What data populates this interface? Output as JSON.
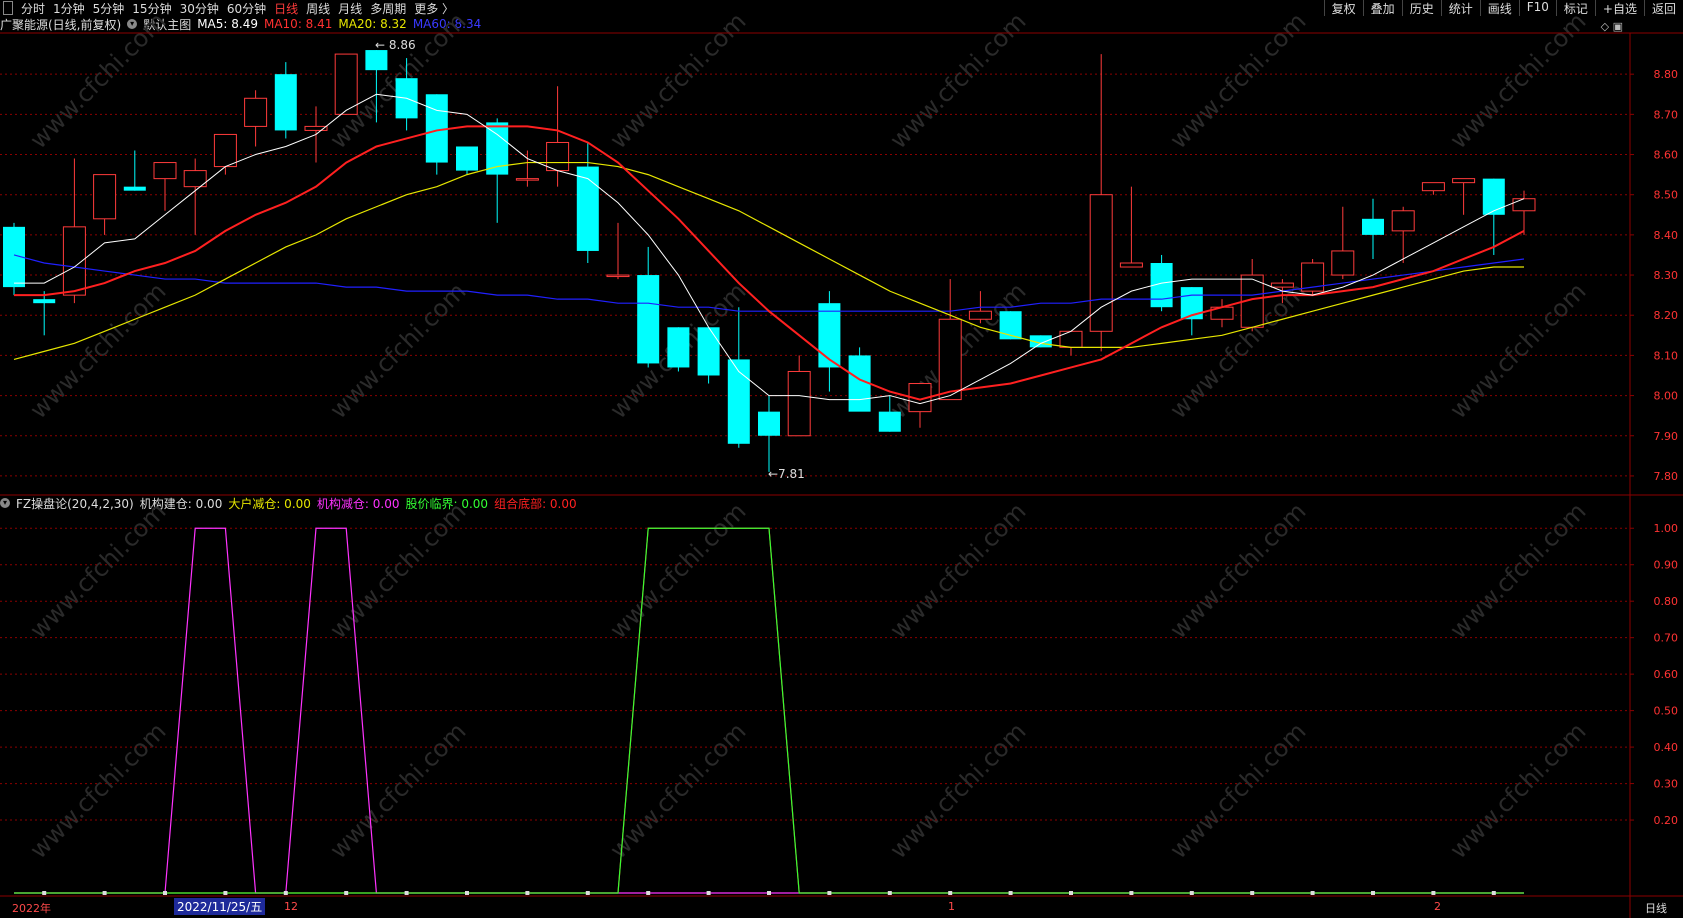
{
  "toolbar": {
    "tabs": [
      "分时",
      "1分钟",
      "5分钟",
      "15分钟",
      "30分钟",
      "60分钟",
      "日线",
      "周线",
      "月线",
      "多周期",
      "更多 〉"
    ],
    "active": "日线",
    "right": [
      "复权",
      "叠加",
      "历史",
      "统计",
      "画线",
      "F10",
      "标记",
      "+自选",
      "返回"
    ]
  },
  "main_info": {
    "stock": "广聚能源(日线,前复权)",
    "template": "默认主图",
    "ma5": "MA5: 8.49",
    "ma10": "MA10: 8.41",
    "ma20": "MA20: 8.32",
    "ma60": "MA60: 8.34"
  },
  "sub_info": {
    "indicator": "FZ操盘论(20,4,2,30)",
    "s1": "机构建仓: 0.00",
    "s2": "大户减仓: 0.00",
    "s3": "机构减仓: 0.00",
    "s4": "股价临界: 0.00",
    "s5": "组合底部: 0.00"
  },
  "annotations": {
    "high": "8.86",
    "low": "7.81"
  },
  "x_axis": {
    "year": "2022年",
    "selected_date": "2022/11/25/五",
    "m12": "12",
    "m1": "1",
    "m2": "2",
    "period": "日线"
  },
  "watermark": "www.cfchi.com",
  "colors": {
    "up": "#ff3b3b",
    "down": "#00ffff",
    "ma5": "#ffffff",
    "ma10": "#ff2020",
    "ma20": "#e6e600",
    "ma60": "#2020ff",
    "grid": "#8b0000"
  },
  "chart_data": [
    {
      "type": "candlestick",
      "title": "广聚能源(日线,前复权)",
      "y_ticks": [
        7.8,
        7.9,
        8.0,
        8.1,
        8.2,
        8.3,
        8.4,
        8.5,
        8.6,
        8.7,
        8.8
      ],
      "ylim": [
        7.76,
        8.9
      ],
      "candles": [
        {
          "o": 8.42,
          "h": 8.43,
          "l": 8.25,
          "c": 8.27
        },
        {
          "o": 8.24,
          "h": 8.26,
          "l": 8.15,
          "c": 8.23
        },
        {
          "o": 8.25,
          "h": 8.59,
          "l": 8.23,
          "c": 8.42
        },
        {
          "o": 8.44,
          "h": 8.55,
          "l": 8.4,
          "c": 8.55
        },
        {
          "o": 8.52,
          "h": 8.61,
          "l": 8.51,
          "c": 8.51
        },
        {
          "o": 8.54,
          "h": 8.55,
          "l": 8.46,
          "c": 8.58
        },
        {
          "o": 8.52,
          "h": 8.59,
          "l": 8.4,
          "c": 8.56
        },
        {
          "o": 8.57,
          "h": 8.65,
          "l": 8.55,
          "c": 8.65
        },
        {
          "o": 8.67,
          "h": 8.76,
          "l": 8.62,
          "c": 8.74
        },
        {
          "o": 8.8,
          "h": 8.83,
          "l": 8.64,
          "c": 8.66
        },
        {
          "o": 8.66,
          "h": 8.72,
          "l": 8.58,
          "c": 8.67
        },
        {
          "o": 8.7,
          "h": 8.85,
          "l": 8.7,
          "c": 8.85
        },
        {
          "o": 8.86,
          "h": 8.86,
          "l": 8.68,
          "c": 8.81
        },
        {
          "o": 8.79,
          "h": 8.84,
          "l": 8.66,
          "c": 8.69
        },
        {
          "o": 8.75,
          "h": 8.75,
          "l": 8.55,
          "c": 8.58
        },
        {
          "o": 8.62,
          "h": 8.62,
          "l": 8.55,
          "c": 8.56
        },
        {
          "o": 8.68,
          "h": 8.69,
          "l": 8.43,
          "c": 8.55
        },
        {
          "o": 8.54,
          "h": 8.61,
          "l": 8.52,
          "c": 8.54
        },
        {
          "o": 8.56,
          "h": 8.77,
          "l": 8.52,
          "c": 8.63
        },
        {
          "o": 8.57,
          "h": 8.63,
          "l": 8.33,
          "c": 8.36
        },
        {
          "o": 8.3,
          "h": 8.43,
          "l": 8.29,
          "c": 8.3
        },
        {
          "o": 8.3,
          "h": 8.37,
          "l": 8.07,
          "c": 8.08
        },
        {
          "o": 8.17,
          "h": 8.17,
          "l": 8.06,
          "c": 8.07
        },
        {
          "o": 8.17,
          "h": 8.17,
          "l": 8.03,
          "c": 8.05
        },
        {
          "o": 8.09,
          "h": 8.22,
          "l": 7.87,
          "c": 7.88
        },
        {
          "o": 7.96,
          "h": 8.0,
          "l": 7.81,
          "c": 7.9
        },
        {
          "o": 7.9,
          "h": 8.1,
          "l": 7.9,
          "c": 8.06
        },
        {
          "o": 8.23,
          "h": 8.26,
          "l": 8.01,
          "c": 8.07
        },
        {
          "o": 8.1,
          "h": 8.12,
          "l": 7.97,
          "c": 7.96
        },
        {
          "o": 7.96,
          "h": 8.0,
          "l": 7.91,
          "c": 7.91
        },
        {
          "o": 7.96,
          "h": 8.02,
          "l": 7.92,
          "c": 8.03
        },
        {
          "o": 7.99,
          "h": 8.29,
          "l": 7.99,
          "c": 8.19
        },
        {
          "o": 8.19,
          "h": 8.26,
          "l": 8.18,
          "c": 8.21
        },
        {
          "o": 8.21,
          "h": 8.21,
          "l": 8.14,
          "c": 8.14
        },
        {
          "o": 8.15,
          "h": 8.15,
          "l": 8.12,
          "c": 8.12
        },
        {
          "o": 8.12,
          "h": 8.15,
          "l": 8.1,
          "c": 8.16
        },
        {
          "o": 8.16,
          "h": 8.85,
          "l": 8.11,
          "c": 8.5
        },
        {
          "o": 8.32,
          "h": 8.52,
          "l": 8.32,
          "c": 8.33
        },
        {
          "o": 8.33,
          "h": 8.35,
          "l": 8.21,
          "c": 8.22
        },
        {
          "o": 8.27,
          "h": 8.27,
          "l": 8.15,
          "c": 8.19
        },
        {
          "o": 8.19,
          "h": 8.24,
          "l": 8.17,
          "c": 8.22
        },
        {
          "o": 8.17,
          "h": 8.34,
          "l": 8.16,
          "c": 8.3
        },
        {
          "o": 8.27,
          "h": 8.29,
          "l": 8.23,
          "c": 8.28
        },
        {
          "o": 8.26,
          "h": 8.34,
          "l": 8.25,
          "c": 8.33
        },
        {
          "o": 8.3,
          "h": 8.47,
          "l": 8.29,
          "c": 8.36
        },
        {
          "o": 8.44,
          "h": 8.49,
          "l": 8.34,
          "c": 8.4
        },
        {
          "o": 8.41,
          "h": 8.47,
          "l": 8.33,
          "c": 8.46
        },
        {
          "o": 8.51,
          "h": 8.53,
          "l": 8.5,
          "c": 8.53
        },
        {
          "o": 8.53,
          "h": 8.54,
          "l": 8.45,
          "c": 8.54
        },
        {
          "o": 8.54,
          "h": 8.54,
          "l": 8.35,
          "c": 8.45
        },
        {
          "o": 8.46,
          "h": 8.51,
          "l": 8.4,
          "c": 8.49
        }
      ],
      "ma5": [
        8.28,
        8.28,
        8.32,
        8.38,
        8.39,
        8.45,
        8.51,
        8.57,
        8.6,
        8.62,
        8.65,
        8.71,
        8.75,
        8.74,
        8.71,
        8.7,
        8.65,
        8.59,
        8.56,
        8.54,
        8.48,
        8.4,
        8.3,
        8.17,
        8.06,
        8.0,
        8.0,
        7.99,
        7.99,
        8.0,
        7.98,
        8.0,
        8.04,
        8.08,
        8.13,
        8.16,
        8.22,
        8.26,
        8.28,
        8.29,
        8.29,
        8.29,
        8.26,
        8.25,
        8.27,
        8.3,
        8.34,
        8.38,
        8.42,
        8.46,
        8.49
      ],
      "ma10": [
        8.25,
        8.25,
        8.26,
        8.28,
        8.31,
        8.33,
        8.36,
        8.41,
        8.45,
        8.48,
        8.52,
        8.58,
        8.62,
        8.64,
        8.66,
        8.67,
        8.67,
        8.67,
        8.66,
        8.63,
        8.58,
        8.51,
        8.44,
        8.36,
        8.28,
        8.21,
        8.15,
        8.09,
        8.04,
        8.01,
        7.99,
        8.01,
        8.02,
        8.03,
        8.05,
        8.07,
        8.09,
        8.13,
        8.17,
        8.2,
        8.22,
        8.24,
        8.25,
        8.25,
        8.26,
        8.27,
        8.29,
        8.31,
        8.34,
        8.37,
        8.41
      ],
      "ma20": [
        8.09,
        8.11,
        8.13,
        8.16,
        8.19,
        8.22,
        8.25,
        8.29,
        8.33,
        8.37,
        8.4,
        8.44,
        8.47,
        8.5,
        8.52,
        8.55,
        8.57,
        8.58,
        8.58,
        8.58,
        8.57,
        8.55,
        8.52,
        8.49,
        8.46,
        8.42,
        8.38,
        8.34,
        8.3,
        8.26,
        8.23,
        8.2,
        8.17,
        8.15,
        8.13,
        8.12,
        8.12,
        8.12,
        8.13,
        8.14,
        8.15,
        8.17,
        8.19,
        8.21,
        8.23,
        8.25,
        8.27,
        8.29,
        8.31,
        8.32,
        8.32
      ],
      "ma60": [
        8.35,
        8.33,
        8.32,
        8.31,
        8.3,
        8.29,
        8.29,
        8.28,
        8.28,
        8.28,
        8.28,
        8.27,
        8.27,
        8.26,
        8.26,
        8.26,
        8.25,
        8.25,
        8.24,
        8.24,
        8.23,
        8.23,
        8.22,
        8.22,
        8.21,
        8.21,
        8.21,
        8.21,
        8.21,
        8.21,
        8.21,
        8.21,
        8.22,
        8.22,
        8.23,
        8.23,
        8.24,
        8.24,
        8.24,
        8.25,
        8.25,
        8.25,
        8.26,
        8.27,
        8.28,
        8.29,
        8.3,
        8.31,
        8.32,
        8.33,
        8.34
      ]
    },
    {
      "type": "line",
      "title": "FZ操盘论(20,4,2,30)",
      "y_ticks": [
        0.2,
        0.3,
        0.4,
        0.5,
        0.6,
        0.7,
        0.8,
        0.9,
        1.0
      ],
      "ylim": [
        0,
        1.05
      ],
      "series": [
        {
          "name": "大户减仓",
          "color": "#ff33ff",
          "values": [
            0,
            0,
            0,
            0,
            0,
            0,
            1,
            1,
            0,
            0,
            1,
            1,
            0,
            0,
            0,
            0,
            0,
            0,
            0,
            0,
            0,
            0,
            0,
            0,
            0,
            0,
            0,
            0,
            0,
            0,
            0,
            0,
            0,
            0,
            0,
            0,
            0,
            0,
            0,
            0,
            0,
            0,
            0,
            0,
            0,
            0,
            0,
            0,
            0,
            0,
            0
          ]
        },
        {
          "name": "组合底部",
          "color": "#ff2020",
          "values": [
            0,
            0,
            0,
            0,
            0,
            0,
            0,
            0,
            0,
            0,
            0,
            0,
            0,
            0,
            0,
            0,
            0,
            0,
            0,
            0,
            0,
            1,
            1,
            1,
            1,
            1,
            0,
            0,
            0,
            0,
            0,
            0,
            0,
            0,
            0,
            0,
            0,
            0,
            0,
            0,
            0,
            0,
            0,
            0,
            0,
            0,
            0,
            0,
            0,
            0,
            0
          ]
        },
        {
          "name": "股价临界",
          "color": "#33ff33",
          "values": [
            0,
            0,
            0,
            0,
            0,
            0,
            0,
            0,
            0,
            0,
            0,
            0,
            0,
            0,
            0,
            0,
            0,
            0,
            0,
            0,
            0,
            1,
            1,
            1,
            1,
            1,
            0,
            0,
            0,
            0,
            0,
            0,
            0,
            0,
            0,
            0,
            0,
            0,
            0,
            0,
            0,
            0,
            0,
            0,
            0,
            0,
            0,
            0,
            0,
            0,
            0
          ]
        }
      ]
    }
  ]
}
